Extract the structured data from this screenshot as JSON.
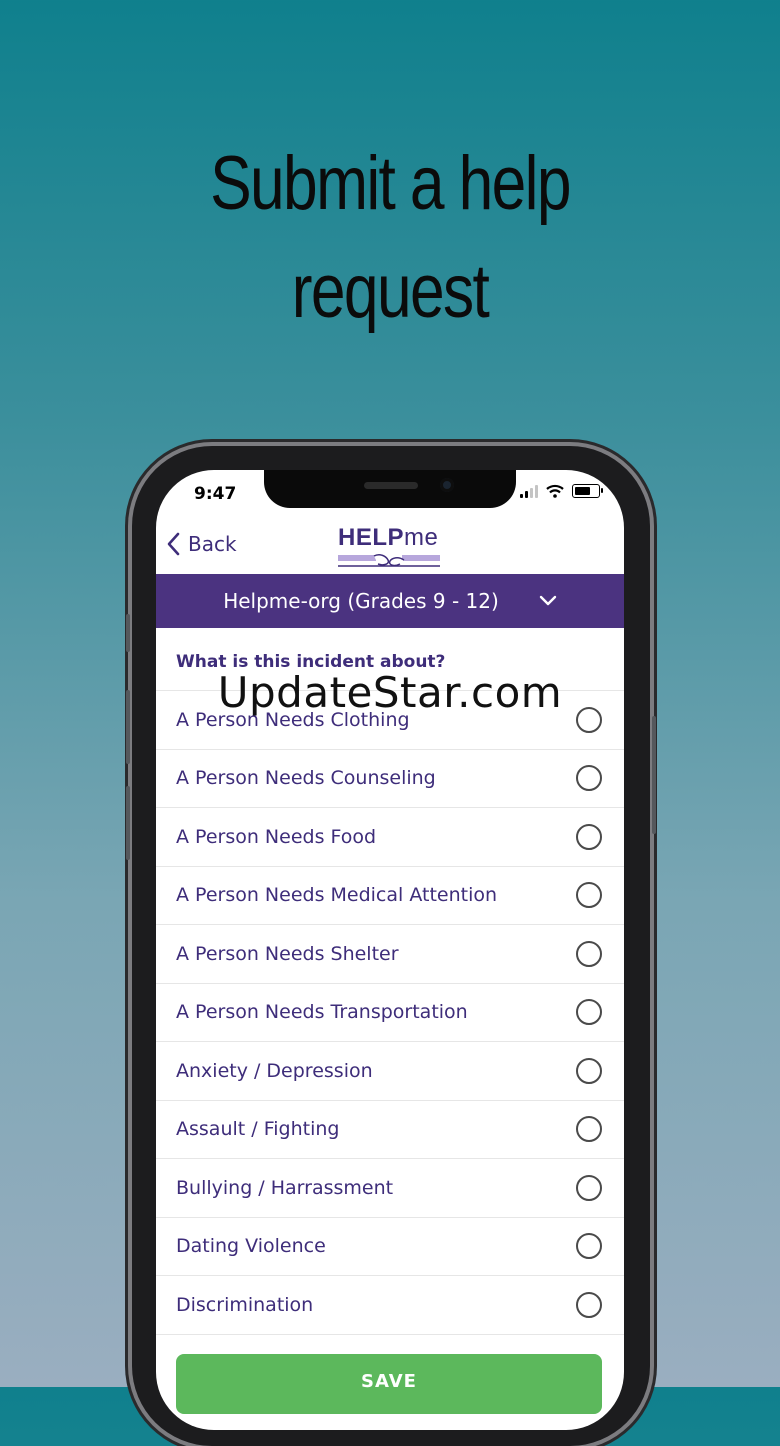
{
  "headline": {
    "line1": "Submit a help",
    "line2": "request"
  },
  "status": {
    "time": "9:47"
  },
  "nav": {
    "back_label": "Back",
    "logo_bold": "HELP",
    "logo_light": "me"
  },
  "org": {
    "name": "Helpme-org (Grades 9 - 12)"
  },
  "question": "What is this incident about?",
  "options": [
    "A Person Needs Clothing",
    "A Person Needs Counseling",
    "A Person Needs Food",
    "A Person Needs Medical Attention",
    "A Person Needs Shelter",
    "A Person Needs Transportation",
    "Anxiety / Depression",
    "Assault / Fighting",
    "Bullying / Harrassment",
    "Dating Violence",
    "Discrimination"
  ],
  "save_label": "SAVE",
  "watermark": "UpdateStar.com",
  "colors": {
    "brand_purple": "#4b3380",
    "text_purple": "#3e2d7a",
    "save_green": "#5cb85c"
  }
}
